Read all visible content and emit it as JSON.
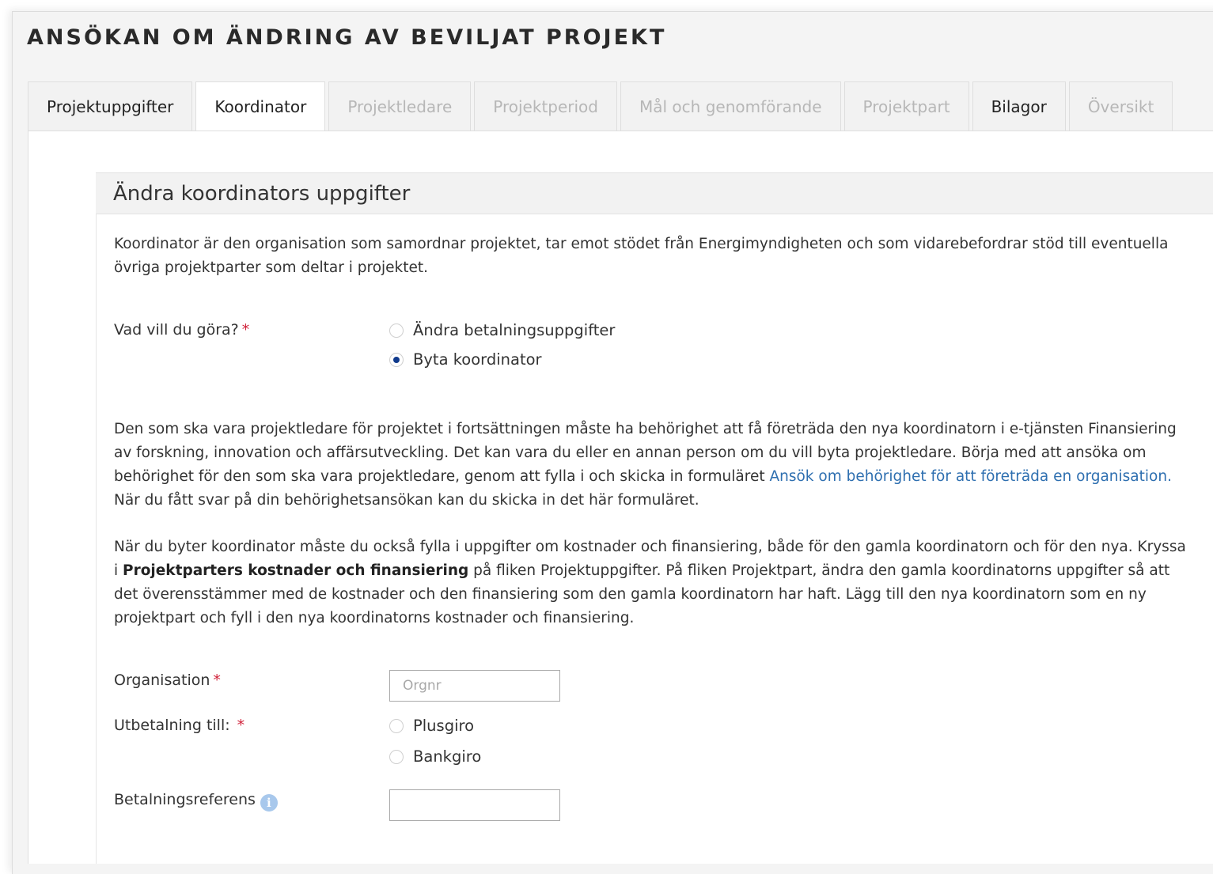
{
  "page": {
    "title": "ANSÖKAN OM ÄNDRING AV BEVILJAT PROJEKT"
  },
  "tabs": [
    {
      "label": "Projektuppgifter",
      "state": "enabled"
    },
    {
      "label": "Koordinator",
      "state": "active"
    },
    {
      "label": "Projektledare",
      "state": "disabled"
    },
    {
      "label": "Projektperiod",
      "state": "disabled"
    },
    {
      "label": "Mål och genomförande",
      "state": "disabled"
    },
    {
      "label": "Projektpart",
      "state": "disabled"
    },
    {
      "label": "Bilagor",
      "state": "enabled"
    },
    {
      "label": "Översikt",
      "state": "disabled"
    }
  ],
  "section": {
    "title": "Ändra koordinators uppgifter",
    "intro": "Koordinator är den organisation som samordnar projektet, tar emot stödet från Energimyndigheten och som vidarebefordrar stöd till eventuella övriga projektparter som deltar i projektet.",
    "info_part1": "Den som ska vara projektledare för projektet i fortsättningen måste ha behörighet att få företräda den nya koordinatorn i e-tjänsten Finansiering av forskning, innovation och affärsutveckling. Det kan vara du eller en annan person om du vill byta projektledare. Börja med att ansöka om behörighet för den som ska vara projektledare, genom att fylla i och skicka in formuläret ",
    "info_link": "Ansök om behörighet för att företräda en organisation.",
    "info_part2": " När du fått svar på din behörighetsansökan kan du skicka in det här formuläret.",
    "cost_part1": "När du byter koordinator måste du också fylla i uppgifter om kostnader och finansiering, både för den gamla koordinatorn och för den nya. Kryssa i ",
    "cost_bold": "Projektparters kostnader och finansiering",
    "cost_part2": " på fliken Projektuppgifter. På fliken Projektpart, ändra den gamla koordinatorns uppgifter så att det överensstämmer med de kostnader och den finansiering som den gamla koordinatorn har haft. Lägg till den nya koordinatorn som en ny projektpart och fyll i den nya koordinatorns kostnader och finansiering."
  },
  "form": {
    "action_label": "Vad vill du göra?",
    "required_mark": "*",
    "action_options": [
      {
        "label": "Ändra betalningsuppgifter",
        "checked": false
      },
      {
        "label": "Byta koordinator",
        "checked": true
      }
    ],
    "organisation_label": "Organisation",
    "organisation_value": "",
    "organisation_placeholder": "Orgnr",
    "payout_label": "Utbetalning till:",
    "payout_options": [
      {
        "label": "Plusgiro",
        "checked": false
      },
      {
        "label": "Bankgiro",
        "checked": false
      }
    ],
    "reference_label": "Betalningsreferens",
    "reference_value": "",
    "info_icon_glyph": "i"
  },
  "colors": {
    "accent_link": "#2e6fb0",
    "required": "#d0223a",
    "radio_selected": "#103a8c",
    "info_icon": "#a8c8ec"
  }
}
